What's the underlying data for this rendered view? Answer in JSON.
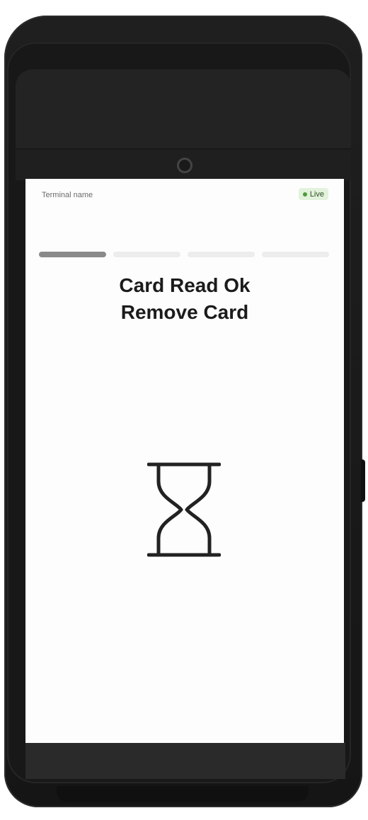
{
  "screen": {
    "terminal_name": "Terminal name",
    "status_badge": "Live",
    "status_color": "#4f9a3c",
    "progress": {
      "steps": 4,
      "active_step": 1
    },
    "message_line1": "Card Read Ok",
    "message_line2": "Remove Card",
    "icon": "hourglass-icon"
  }
}
